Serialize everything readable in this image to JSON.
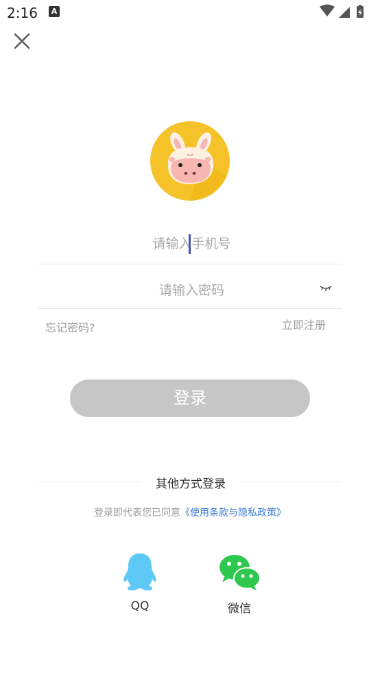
{
  "status_bar": {
    "time": "2:16",
    "notification_icon": "A"
  },
  "form": {
    "phone_placeholder": "请输入手机号",
    "password_placeholder": "请输入密码",
    "forgot_password": "忘记密码?",
    "register": "立即注册",
    "login_button": "登录"
  },
  "other_login": {
    "title": "其他方式登录",
    "agreement_text": "登录即代表您已同意",
    "agreement_link": "《使用条款与隐私政策》",
    "options": [
      {
        "label": "QQ",
        "icon": "qq-penguin-icon",
        "color": "#5ec8f7"
      },
      {
        "label": "微信",
        "icon": "wechat-icon",
        "color": "#2dc84d"
      }
    ]
  },
  "colors": {
    "login_button_bg": "#c6c6c6",
    "link": "#3a7bd5",
    "avatar_bg": "#f6c22a"
  }
}
